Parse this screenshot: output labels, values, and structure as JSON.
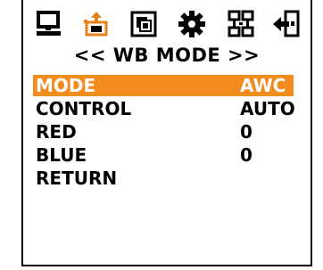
{
  "menu": {
    "title": "<< WB MODE >>",
    "toolbar_icons": [
      {
        "name": "monitor-icon"
      },
      {
        "name": "camera-adjust-icon"
      },
      {
        "name": "image-select-icon"
      },
      {
        "name": "gear-icon"
      },
      {
        "name": "network-icon"
      },
      {
        "name": "exit-icon"
      }
    ],
    "rows": [
      {
        "label": "MODE",
        "value": "AWC",
        "selected": true
      },
      {
        "label": "CONTROL",
        "value": "AUTO",
        "selected": false
      },
      {
        "label": "RED",
        "value": "0",
        "selected": false
      },
      {
        "label": "BLUE",
        "value": "0",
        "selected": false
      },
      {
        "label": "RETURN",
        "value": "",
        "selected": false
      }
    ]
  },
  "colors": {
    "highlight": "#f28c1e",
    "icon_orange": "#e8801a",
    "text": "#000000"
  }
}
